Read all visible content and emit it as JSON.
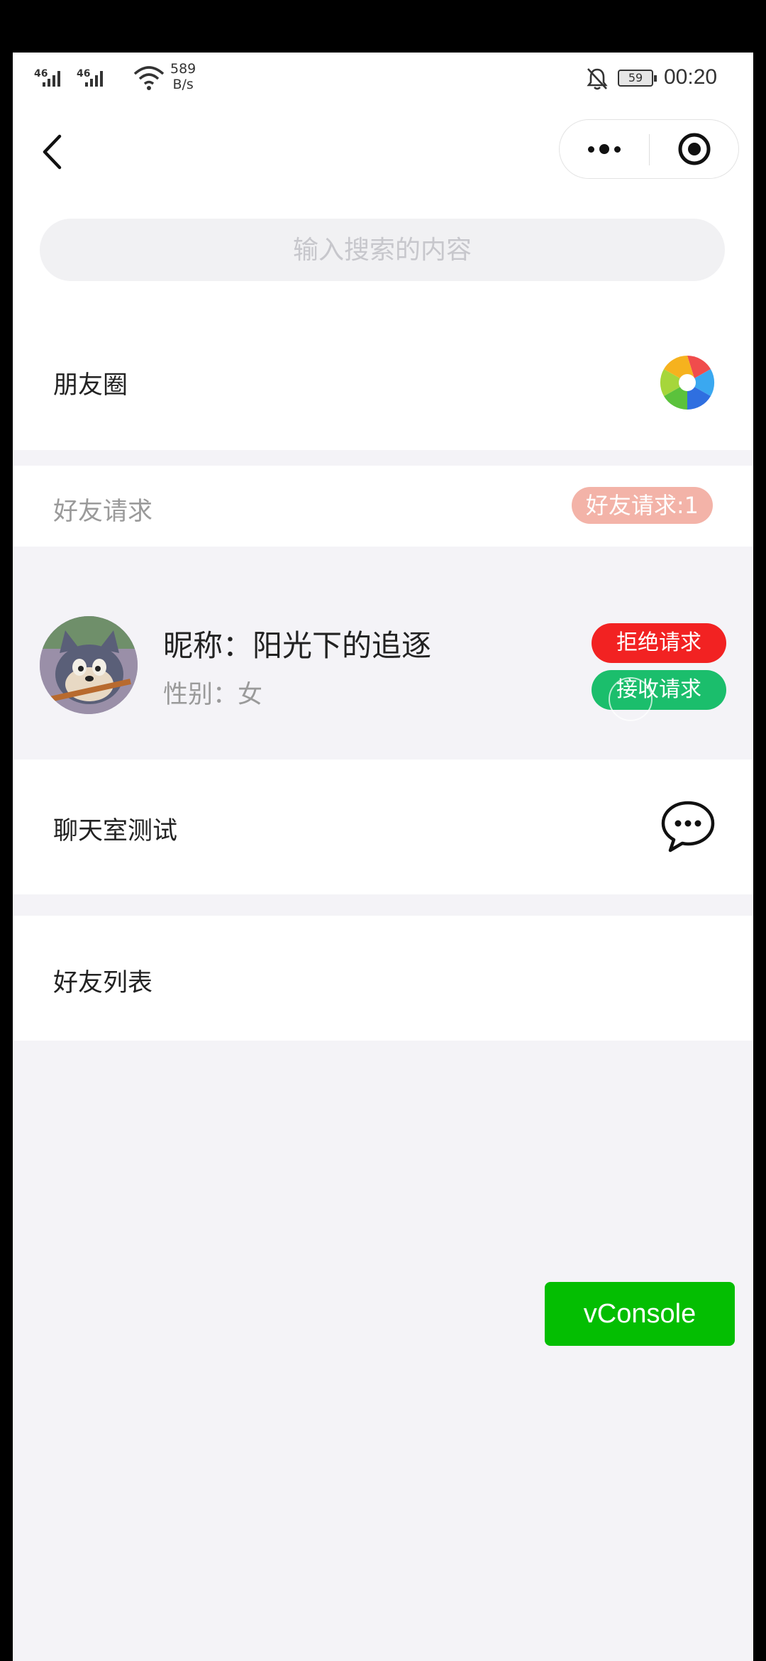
{
  "status_bar": {
    "signal_1": "46",
    "signal_2": "46",
    "net_speed_value": "589",
    "net_speed_unit": "B/s",
    "battery": "59",
    "time": "00:20"
  },
  "search": {
    "placeholder": "输入搜索的内容"
  },
  "moments": {
    "label": "朋友圈"
  },
  "friend_requests": {
    "header_label": "好友请求",
    "badge": "好友请求:1",
    "items": [
      {
        "nickname": "昵称：阳光下的追逐",
        "gender": "性别：女",
        "reject_label": "拒绝请求",
        "accept_label": "接收请求"
      }
    ]
  },
  "chat_room": {
    "label": "聊天室测试"
  },
  "friend_list": {
    "label": "好友列表"
  },
  "vconsole": {
    "label": "vConsole"
  },
  "colors": {
    "reject": "#f22222",
    "accept": "#1bbe6c",
    "badge": "#f3b3a8",
    "vconsole": "#04be02"
  }
}
